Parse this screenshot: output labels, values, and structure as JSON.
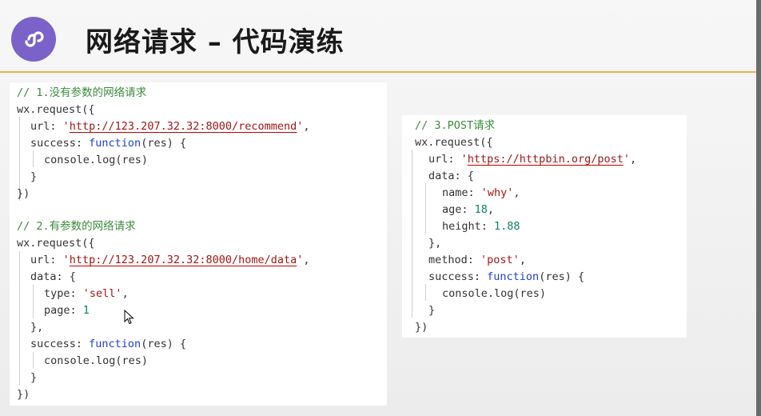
{
  "slide": {
    "title": "网络请求 – 代码演练",
    "logo_icon": "mini-program-icon",
    "accent_color": "#f2b04a",
    "logo_color": "#7a62c8"
  },
  "code_block_1": {
    "lines": [
      {
        "comment": "// 1.没有参数的网络请求"
      },
      {
        "text": "wx.request({"
      },
      {
        "pre": "url: ",
        "q1": "'",
        "url": "http://123.207.32.32:8000/recommend",
        "q2": "'",
        "post": ","
      },
      {
        "pre": "success: ",
        "kw": "function",
        "post": "(res) {"
      },
      {
        "text": "console.log(res)"
      },
      {
        "text": "}"
      },
      {
        "text": "})"
      },
      {
        "comment": "// 2.有参数的网络请求"
      },
      {
        "text": "wx.request({"
      },
      {
        "pre": "url: ",
        "q1": "'",
        "url": "http://123.207.32.32:8000/home/data",
        "q2": "'",
        "post": ","
      },
      {
        "text": "data: {"
      },
      {
        "pre": "type: ",
        "str": "'sell'",
        "post": ","
      },
      {
        "pre": "page: ",
        "num": "1"
      },
      {
        "text": "},"
      },
      {
        "pre": "success: ",
        "kw": "function",
        "post": "(res) {"
      },
      {
        "text": "console.log(res)"
      },
      {
        "text": "}"
      },
      {
        "text": "})"
      }
    ]
  },
  "code_block_2": {
    "lines": [
      {
        "comment": "// 3.POST请求"
      },
      {
        "text": "wx.request({"
      },
      {
        "pre": "url: ",
        "q1": "'",
        "url": "https://httpbin.org/post",
        "q2": "'",
        "post": ","
      },
      {
        "text": "data: {"
      },
      {
        "pre": "name: ",
        "str": "'why'",
        "post": ","
      },
      {
        "pre": "age: ",
        "num": "18",
        "post": ","
      },
      {
        "pre": "height: ",
        "num": "1.88"
      },
      {
        "text": "},"
      },
      {
        "pre": "method: ",
        "str": "'post'",
        "post": ","
      },
      {
        "pre": "success: ",
        "kw": "function",
        "post": "(res) {"
      },
      {
        "text": "console.log(res)"
      },
      {
        "text": "}"
      },
      {
        "text": "})"
      }
    ]
  }
}
